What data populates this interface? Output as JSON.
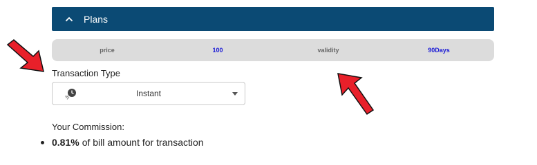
{
  "accordion": {
    "title": "Plans",
    "bg_color": "#0b4a74",
    "icon": "chevron-up-icon"
  },
  "plan": {
    "price_label": "price",
    "price_value": "100",
    "validity_label": "validity",
    "validity_value": "90Days"
  },
  "transaction_type": {
    "label": "Transaction Type",
    "selected": "Instant",
    "icon": "clock-fast-icon"
  },
  "commission": {
    "label": "Your Commission:",
    "rate": "0.81%",
    "text": "of bill amount for transaction"
  },
  "annotations": {
    "arrow_color": "#e8202a"
  }
}
